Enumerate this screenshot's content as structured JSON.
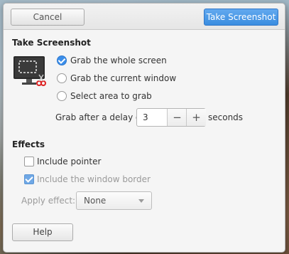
{
  "header": {
    "cancel_label": "Cancel",
    "take_label": "Take Screenshot"
  },
  "take_screenshot": {
    "title": "Take Screenshot",
    "options": [
      {
        "label": "Grab the whole screen",
        "checked": true
      },
      {
        "label": "Grab the current window",
        "checked": false
      },
      {
        "label": "Select area to grab",
        "checked": false
      }
    ],
    "delay_label": "Grab after a delay of",
    "delay_value": "3",
    "delay_unit": "seconds",
    "decrement_symbol": "−",
    "increment_symbol": "+",
    "icon": "screenshot-monitor-icon"
  },
  "effects": {
    "title": "Effects",
    "include_pointer": {
      "label": "Include pointer",
      "checked": false
    },
    "include_border": {
      "label": "Include the window border",
      "checked": true,
      "disabled": true
    },
    "apply_effect_label": "Apply effect:",
    "apply_effect_value": "None"
  },
  "footer": {
    "help_label": "Help"
  },
  "colors": {
    "accent": "#3b8eea",
    "primary_button": "#3a8de0"
  }
}
